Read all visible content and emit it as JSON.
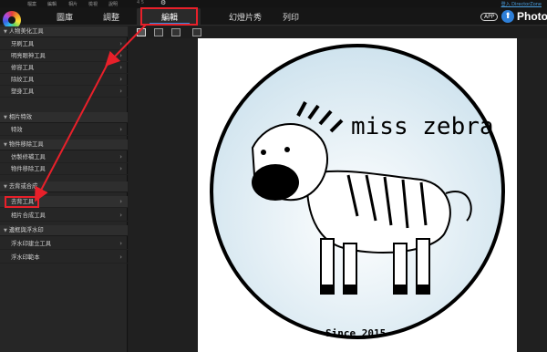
{
  "menubar": {
    "items": [
      "檔案",
      "編輯",
      "相片",
      "檢視",
      "說明"
    ],
    "version": "4  5",
    "login": "登入 DirectorZone"
  },
  "tabs": [
    {
      "label": "圖庫"
    },
    {
      "label": "調整"
    },
    {
      "label": "編輯"
    },
    {
      "label": "幻燈片秀"
    },
    {
      "label": "列印"
    }
  ],
  "header_right": {
    "app_badge": "APP",
    "brand": "Photo"
  },
  "sidebar": {
    "sections": [
      {
        "title": "人物美化工具",
        "items": [
          "牙刷工具",
          "明亮眼神工具",
          "修容工具",
          "除紋工具",
          "塑身工具"
        ]
      },
      {
        "title": "相片特效",
        "items": [
          "特效"
        ]
      },
      {
        "title": "物件移除工具",
        "items": [
          "仿製修補工具",
          "物件移除工具"
        ]
      },
      {
        "title": "去背或合成",
        "items": [
          "去背工具",
          "相片合成工具"
        ]
      },
      {
        "title": "邊框與浮水印",
        "items": [
          "浮水印建立工具",
          "浮水印範本"
        ]
      }
    ]
  },
  "photo": {
    "title_text": "miss zebra",
    "footer_text": "Since 2015"
  },
  "colors": {
    "accent": "#2e8fe6",
    "highlight_annotation": "#e8202a",
    "sidebar_bg": "#262626"
  },
  "icons": [
    "app-logo-icon",
    "settings-gear-icon",
    "upload-icon",
    "chevron-right-icon"
  ]
}
